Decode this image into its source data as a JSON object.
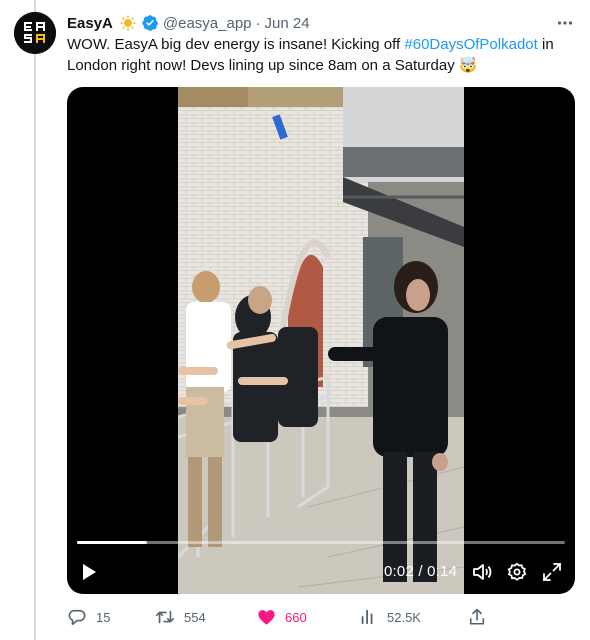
{
  "tweet": {
    "author_name": "EasyA",
    "handle": "@easya_app",
    "separator": "·",
    "date": "Jun 24",
    "avatar_text": "EASY A",
    "text_before": "WOW. EasyA big dev energy is insane! Kicking off ",
    "hashtag": "#60DaysOfPolkadot",
    "text_after": " in London right now! Devs lining up since 8am on a Saturday ",
    "emoji": "🤯"
  },
  "video": {
    "current_time": "0:02",
    "time_separator": "/",
    "duration": "0:14",
    "progress_fraction": 0.143
  },
  "actions": {
    "replies": "15",
    "reposts": "554",
    "likes": "660",
    "views": "52.5K"
  },
  "colors": {
    "link": "#1d9bf0",
    "like": "#f91880",
    "muted": "#536471",
    "verified": "#1d9bf0",
    "sun": "#f7b928"
  },
  "icons": [
    "sun-icon",
    "verified-icon",
    "more-icon",
    "play-icon",
    "volume-icon",
    "settings-icon",
    "fullscreen-icon",
    "reply-icon",
    "repost-icon",
    "heart-icon",
    "views-icon",
    "share-icon"
  ]
}
